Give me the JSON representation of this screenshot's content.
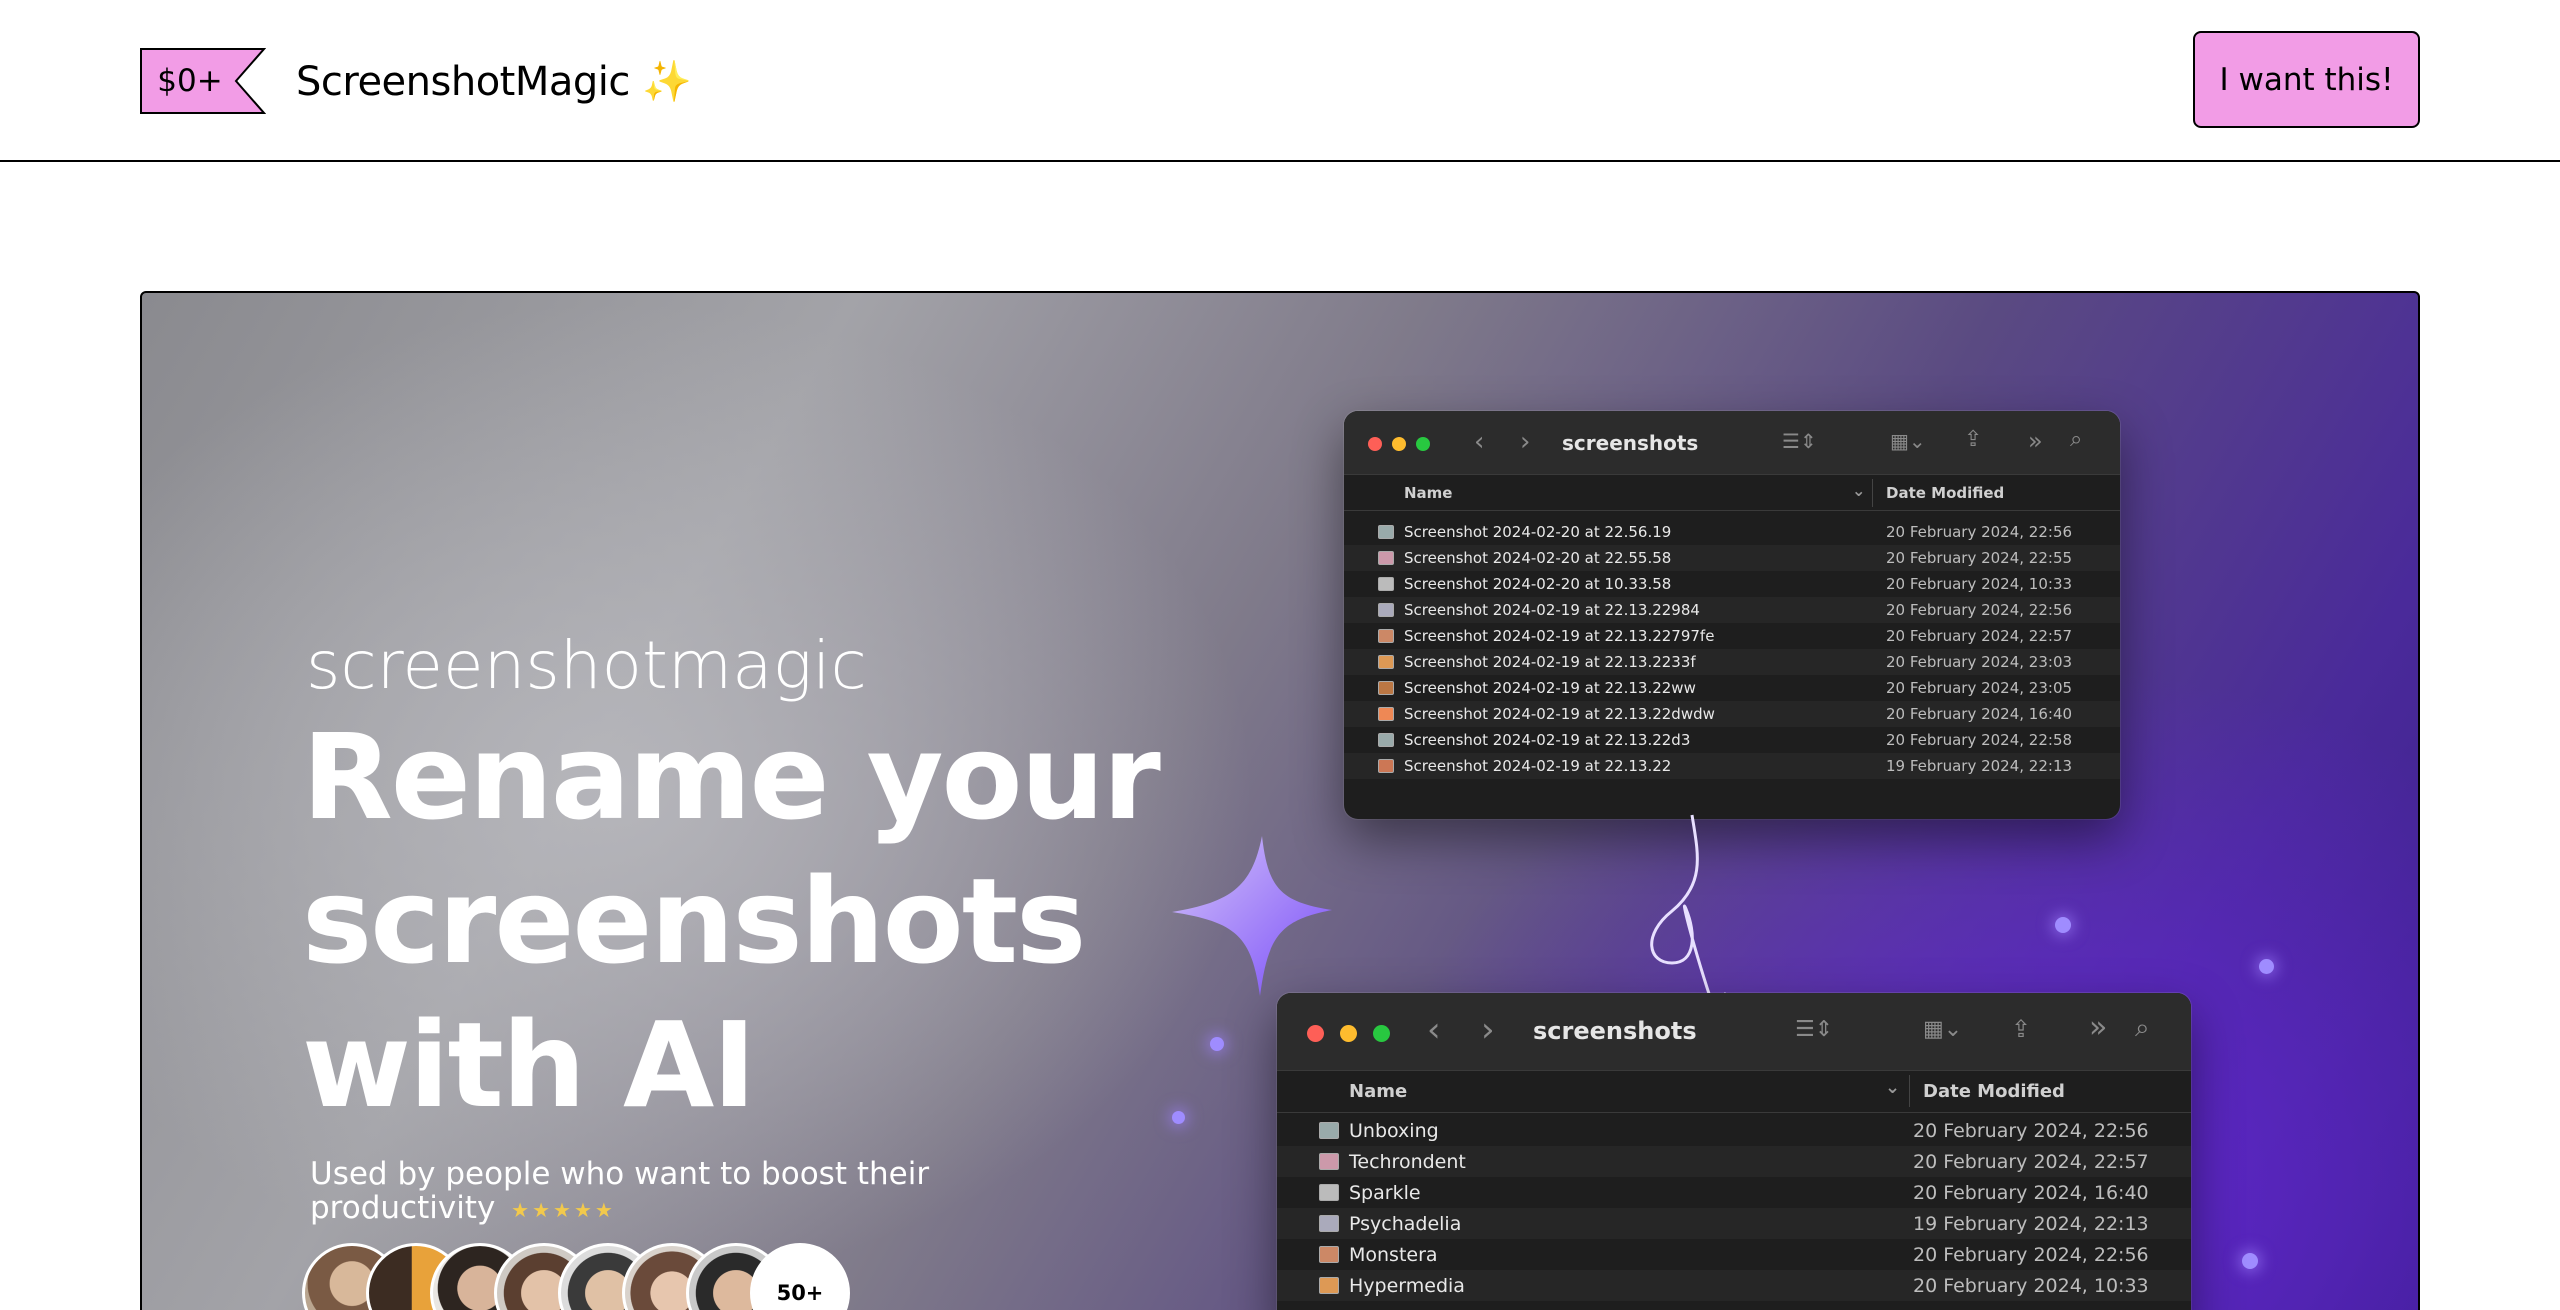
{
  "header": {
    "price": "$0+",
    "brand": "ScreenshotMagic",
    "brand_emoji": "✨",
    "cta_label": "I want this!"
  },
  "hero": {
    "eyebrow": "screenshotmagic",
    "title_lines": [
      "Rename your",
      "screenshots",
      "with AI"
    ],
    "subtitle": "Used by people who want to boost their productivity",
    "stars": "★★★★★",
    "rating": 5,
    "avatar_more": "50+"
  },
  "finder_before": {
    "title": "screenshots",
    "col_name": "Name",
    "col_date": "Date Modified",
    "rows": [
      {
        "name": "Screenshot 2024-02-20 at 22.56.19",
        "date": "20 February 2024, 22:56"
      },
      {
        "name": "Screenshot 2024-02-20 at 22.55.58",
        "date": "20 February 2024, 22:55"
      },
      {
        "name": "Screenshot 2024-02-20 at 10.33.58",
        "date": "20 February 2024, 10:33"
      },
      {
        "name": "Screenshot 2024-02-19 at 22.13.22984",
        "date": "20 February 2024, 22:56"
      },
      {
        "name": "Screenshot 2024-02-19 at 22.13.22797fe",
        "date": "20 February 2024, 22:57"
      },
      {
        "name": "Screenshot 2024-02-19 at 22.13.2233f",
        "date": "20 February 2024, 23:03"
      },
      {
        "name": "Screenshot 2024-02-19 at 22.13.22ww",
        "date": "20 February 2024, 23:05"
      },
      {
        "name": "Screenshot 2024-02-19 at 22.13.22dwdw",
        "date": "20 February 2024, 16:40"
      },
      {
        "name": "Screenshot 2024-02-19 at 22.13.22d3",
        "date": "20 February 2024, 22:58"
      },
      {
        "name": "Screenshot 2024-02-19 at 22.13.22",
        "date": "19 February 2024, 22:13"
      }
    ]
  },
  "finder_after": {
    "title": "screenshots",
    "col_name": "Name",
    "col_date": "Date Modified",
    "rows": [
      {
        "name": "Unboxing",
        "date": "20 February 2024, 22:56"
      },
      {
        "name": "Techrondent",
        "date": "20 February 2024, 22:57"
      },
      {
        "name": "Sparkle",
        "date": "20 February 2024, 16:40"
      },
      {
        "name": "Psychadelia",
        "date": "19 February 2024, 22:13"
      },
      {
        "name": "Monstera",
        "date": "20 February 2024, 22:56"
      },
      {
        "name": "Hypermedia",
        "date": "20 February 2024, 10:33"
      }
    ]
  },
  "colors": {
    "cta": "#f29ce6",
    "accent_purple": "#6b2fd6",
    "star": "#f2c94c"
  }
}
